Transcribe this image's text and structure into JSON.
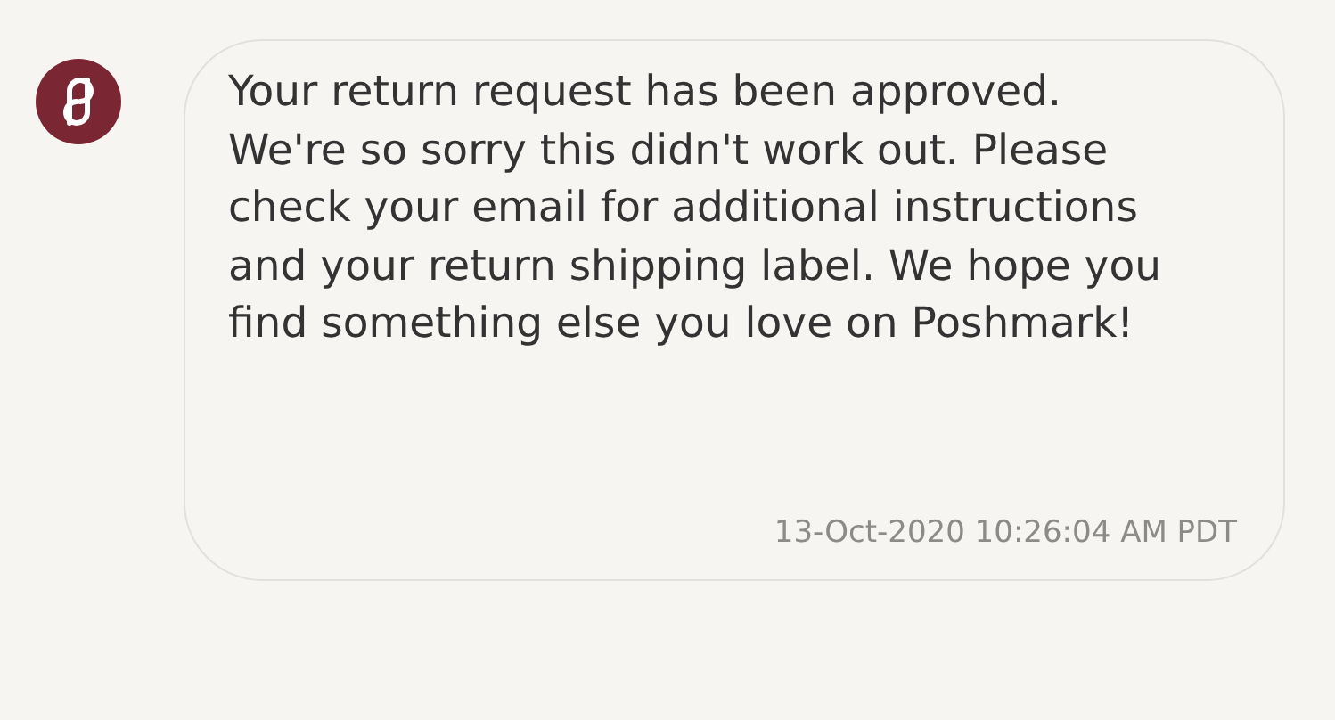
{
  "message": {
    "text": "Your return request has been approved. We're so sorry this didn't work out. Please check your email for additional instructions and your return shipping label. We hope you find something else you love on Poshmark!",
    "timestamp": "13-Oct-2020 10:26:04 AM PDT"
  }
}
